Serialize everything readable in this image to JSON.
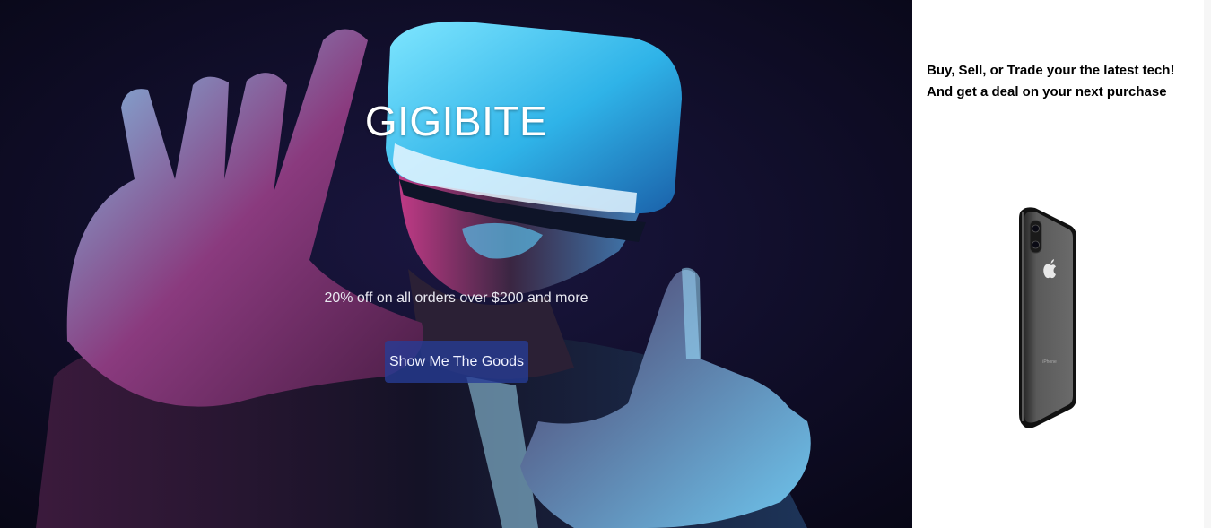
{
  "hero": {
    "brand": "GIGIBITE",
    "tagline": "20% off on all orders over $200 and more",
    "cta_label": "Show Me The Goods",
    "image": "vr-headset-person-photo"
  },
  "promo": {
    "line1": "Buy, Sell, or Trade your the latest tech!",
    "line2": "And get a deal on your next purchase",
    "image": "smartphone-rear-photo",
    "phone_label": "iPhone"
  },
  "colors": {
    "hero_bg": "#0c0a22",
    "cyan_accent": "#2fb3e8",
    "magenta_accent": "#d6307a",
    "button_bg": "#263c96"
  }
}
